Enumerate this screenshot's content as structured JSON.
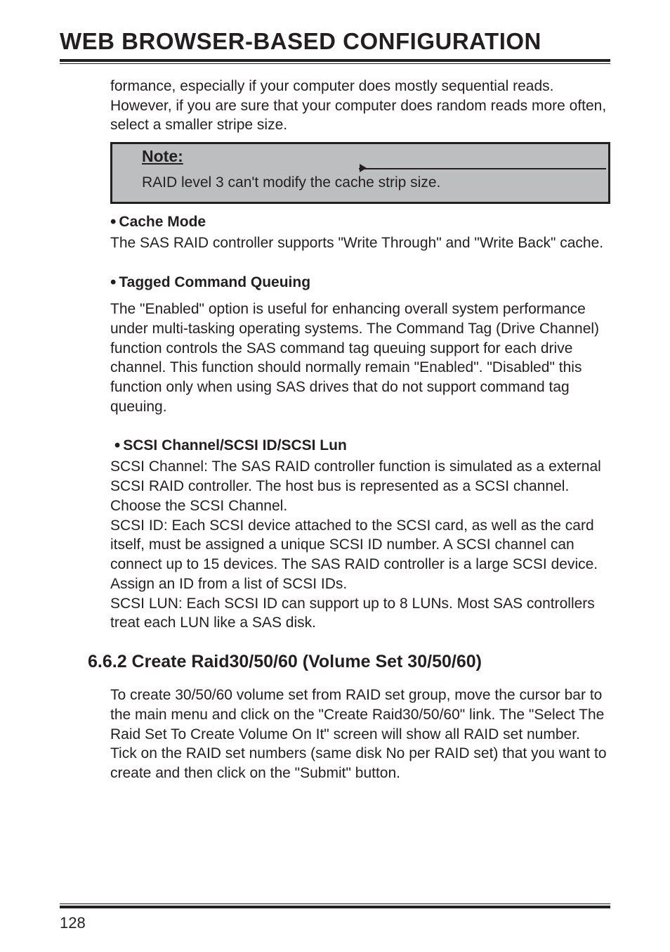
{
  "header": {
    "title": "WEB BROWSER-BASED CONFIGURATION"
  },
  "intro_paragraph": "formance, especially if your computer does mostly sequential reads. However, if you are sure that your computer does random reads more often, select a smaller stripe size.",
  "note": {
    "label": "Note:",
    "body": "RAID level 3 can't modify the cache strip size."
  },
  "sections": [
    {
      "bullet_title": "Cache Mode",
      "body": "The SAS RAID controller supports \"Write Through\" and \"Write Back\" cache."
    },
    {
      "bullet_title": "Tagged Command Queuing",
      "body": "The \"Enabled\" option is useful for enhancing overall system performance under multi-tasking operating systems. The Command Tag (Drive Channel) function controls the SAS command tag queuing support for each drive channel. This function should normally remain \"Enabled\". \"Disabled\" this function only when using SAS drives that do not support command tag queuing."
    },
    {
      "bullet_title": "SCSI Channel/SCSI ID/SCSI Lun",
      "body": "SCSI Channel: The SAS RAID controller function is simulated as a external SCSI RAID controller. The host bus is represented as a SCSI channel. Choose the SCSI Channel.\nSCSI ID: Each SCSI device attached to the SCSI card, as well as the card itself, must be assigned a unique SCSI ID number. A SCSI channel can connect up to 15 devices. The SAS RAID controller is a large SCSI device. Assign an ID from a list of SCSI IDs.\nSCSI LUN: Each SCSI ID can support up to 8 LUNs. Most SAS controllers treat each LUN like a SAS disk."
    }
  ],
  "subsection": {
    "heading": "6.6.2 Create Raid30/50/60 (Volume Set 30/50/60)",
    "body": "To create 30/50/60 volume set from RAID set group, move the cursor bar to the main menu and click on the \"Create Raid30/50/60\" link. The \"Select The Raid Set To Create Volume On It\" screen will show all RAID set number. Tick on the RAID set numbers (same disk No per RAID set) that you want to create and then click on the \"Submit\" button."
  },
  "page_number": "128"
}
